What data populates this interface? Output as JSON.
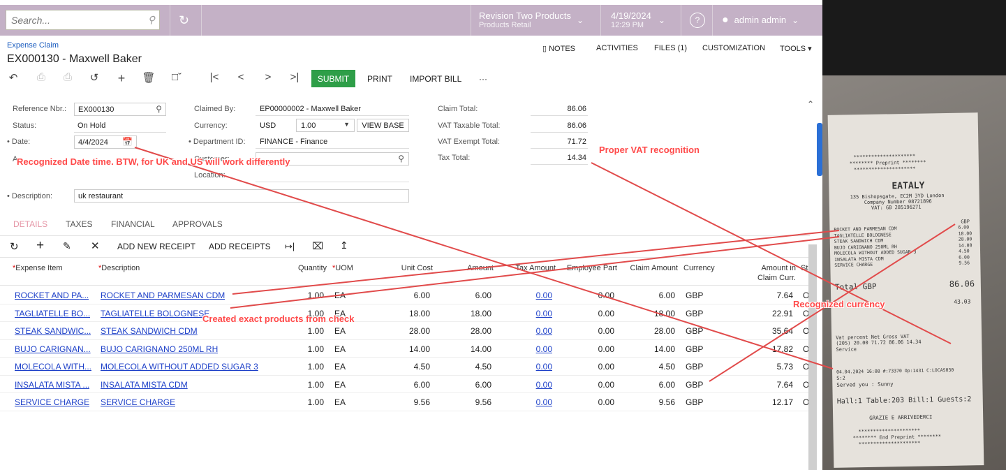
{
  "topbar": {
    "search_placeholder": "Search...",
    "company": "Revision Two Products",
    "branch": "Products Retail",
    "date": "4/19/2024",
    "time": "12:29 PM",
    "user": "admin admin"
  },
  "header": {
    "breadcrumb": "Expense Claim",
    "title": "EX000130 - Maxwell Baker",
    "links": [
      "NOTES",
      "ACTIVITIES",
      "FILES (1)",
      "CUSTOMIZATION",
      "TOOLS"
    ],
    "submit": "SUBMIT",
    "print": "PRINT",
    "import_bill": "IMPORT BILL",
    "more": "···"
  },
  "form": {
    "ref_label": "Reference Nbr.:",
    "ref_value": "EX000130",
    "status_label": "Status:",
    "status_value": "On Hold",
    "date_label": "Date:",
    "date_value": "4/4/2024",
    "claimed_label": "Claimed By:",
    "claimed_value": "EP00000002 - Maxwell Baker",
    "currency_label": "Currency:",
    "currency_value": "USD",
    "rate_value": "1.00",
    "view_base": "VIEW BASE",
    "dept_label": "Department ID:",
    "dept_value": "FINANCE - Finance",
    "customer_label": "Customer:",
    "location_label": "Location:",
    "approval_label_fragment": "A",
    "desc_label": "Description:",
    "desc_value": "uk restaurant",
    "claim_total_label": "Claim Total:",
    "claim_total": "86.06",
    "vat_taxable_label": "VAT Taxable Total:",
    "vat_taxable": "86.06",
    "vat_exempt_label": "VAT Exempt Total:",
    "vat_exempt": "71.72",
    "tax_total_label": "Tax Total:",
    "tax_total": "14.34"
  },
  "tabs": [
    "DETAILS",
    "TAXES",
    "FINANCIAL",
    "APPROVALS"
  ],
  "grid_toolbar": {
    "add_new_receipt": "ADD NEW RECEIPT",
    "add_receipts": "ADD RECEIPTS"
  },
  "grid": {
    "columns": [
      "Expense Item",
      "Description",
      "Quantity",
      "UOM",
      "Unit Cost",
      "Amount",
      "Tax Amount",
      "Employee Part",
      "Claim Amount",
      "Currency",
      "Amount in Claim Curr.",
      "St"
    ],
    "rows": [
      {
        "item": "ROCKET AND PA...",
        "desc": "ROCKET AND PARMESAN CDM",
        "qty": "1.00",
        "uom": "EA",
        "cost": "6.00",
        "amount": "6.00",
        "tax": "0.00",
        "emp": "0.00",
        "claim": "6.00",
        "cur": "GBP",
        "amtclaim": "7.64",
        "st": "O"
      },
      {
        "item": "TAGLIATELLE BO...",
        "desc": "TAGLIATELLE BOLOGNESE",
        "qty": "1.00",
        "uom": "EA",
        "cost": "18.00",
        "amount": "18.00",
        "tax": "0.00",
        "emp": "0.00",
        "claim": "18.00",
        "cur": "GBP",
        "amtclaim": "22.91",
        "st": "O"
      },
      {
        "item": "STEAK SANDWIC...",
        "desc": "STEAK SANDWICH CDM",
        "qty": "1.00",
        "uom": "EA",
        "cost": "28.00",
        "amount": "28.00",
        "tax": "0.00",
        "emp": "0.00",
        "claim": "28.00",
        "cur": "GBP",
        "amtclaim": "35.64",
        "st": "O"
      },
      {
        "item": "BUJO CARIGNAN...",
        "desc": "BUJO CARIGNANO 250ML RH",
        "qty": "1.00",
        "uom": "EA",
        "cost": "14.00",
        "amount": "14.00",
        "tax": "0.00",
        "emp": "0.00",
        "claim": "14.00",
        "cur": "GBP",
        "amtclaim": "17.82",
        "st": "O"
      },
      {
        "item": "MOLECOLA WITH...",
        "desc": "MOLECOLA WITHOUT ADDED SUGAR 3",
        "qty": "1.00",
        "uom": "EA",
        "cost": "4.50",
        "amount": "4.50",
        "tax": "0.00",
        "emp": "0.00",
        "claim": "4.50",
        "cur": "GBP",
        "amtclaim": "5.73",
        "st": "O"
      },
      {
        "item": "INSALATA MISTA ...",
        "desc": "INSALATA MISTA CDM",
        "qty": "1.00",
        "uom": "EA",
        "cost": "6.00",
        "amount": "6.00",
        "tax": "0.00",
        "emp": "0.00",
        "claim": "6.00",
        "cur": "GBP",
        "amtclaim": "7.64",
        "st": "O"
      },
      {
        "item": "SERVICE CHARGE",
        "desc": "SERVICE CHARGE",
        "qty": "1.00",
        "uom": "EA",
        "cost": "9.56",
        "amount": "9.56",
        "tax": "0.00",
        "emp": "0.00",
        "claim": "9.56",
        "cur": "GBP",
        "amtclaim": "12.17",
        "st": "O"
      }
    ]
  },
  "annotations": {
    "date": "Recognized Date time. BTW, for UK and US will work differently",
    "vat": "Proper VAT recognition",
    "products": "Created exact products from check",
    "currency": "Recognized currency"
  },
  "receipt": {
    "stars1": "*********************",
    "preprint": "******** Preprint ********",
    "stars2": "*********************",
    "name": "EATALY",
    "addr": "135 Bishopsgate, EC2M 3YD London",
    "company": "Company Number 08721896",
    "vat": "VAT: GB 285196271",
    "gbp": "GBP",
    "items": [
      {
        "n": "ROCKET AND PARMESAN CDM",
        "v": "6.00"
      },
      {
        "n": "TAGLIATELLE BOLOGNESE",
        "v": "18.00"
      },
      {
        "n": "STEAK SANDWICH CDM",
        "v": "28.00"
      },
      {
        "n": "BUJO CARIGNANO 250ML RH",
        "v": "14.00"
      },
      {
        "n": "MOLECOLA WITHOUT ADDED SUGAR 3",
        "v": "4.50"
      },
      {
        "n": "INSALATA MISTA CDM",
        "v": "6.00"
      },
      {
        "n": "SERVICE CHARGE",
        "v": "9.56"
      }
    ],
    "total_label": "Total GBP",
    "total": "86.06",
    "sub": "43.03",
    "vat_head": "Vat percent    Net   Gross      VAT",
    "vat_row": "(20S) 20.00  71.72  86.06    14.34",
    "service": "Service",
    "datetime": "04.04.2024 16:08 #:73370 Op:1431 C:LOCAS030",
    "s2": "S:2",
    "served": "Served you : Sunny",
    "hall": "Hall:1 Table:203 Bill:1 Guests:2",
    "thanks": "GRAZIE E ARRIVEDERCI",
    "stars3": "*********************",
    "endpre": "******** End Preprint ********",
    "stars4": "*********************"
  }
}
